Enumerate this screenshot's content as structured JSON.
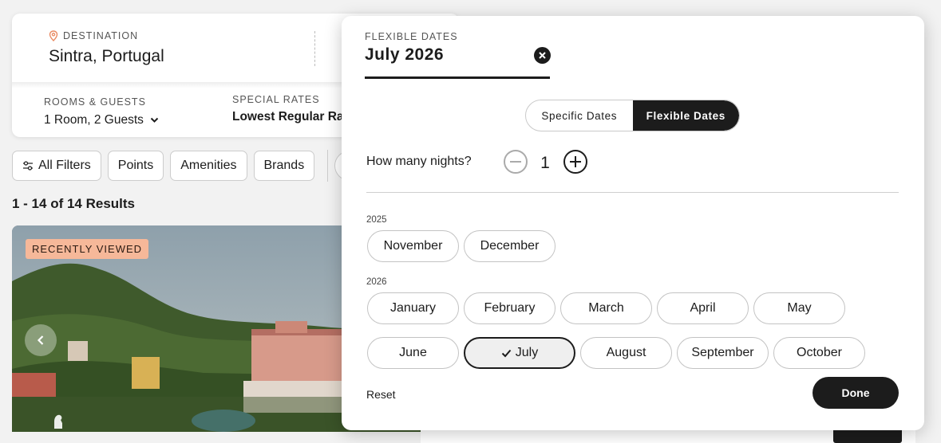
{
  "search": {
    "destination_label": "DESTINATION",
    "destination_value": "Sintra, Portugal",
    "rooms_label": "ROOMS & GUESTS",
    "rooms_value": "1 Room, 2 Guests",
    "special_rates_label": "SPECIAL RATES",
    "special_rates_value": "Lowest Regular Rate"
  },
  "filters": [
    {
      "label": "All Filters",
      "icon": "sliders-icon"
    },
    {
      "label": "Points"
    },
    {
      "label": "Amenities"
    },
    {
      "label": "Brands"
    }
  ],
  "results": {
    "count_text": "1 - 14 of 14 Results"
  },
  "hotel_card": {
    "badge": "RECENTLY VIEWED"
  },
  "picker": {
    "flexible_label": "FLEXIBLE DATES",
    "selected_value": "July 2026",
    "toggle": {
      "specific": "Specific Dates",
      "flexible": "Flexible Dates",
      "active": "flexible"
    },
    "nights_label": "How many nights?",
    "nights_value": "1",
    "years": [
      {
        "year": "2025",
        "months": [
          "November",
          "December"
        ]
      },
      {
        "year": "2026",
        "months": [
          "January",
          "February",
          "March",
          "April",
          "May"
        ],
        "months_row2": [
          "June",
          "July",
          "August",
          "September",
          "October"
        ]
      }
    ],
    "selected_month": "July",
    "reset_label": "Reset",
    "done_label": "Done"
  },
  "colors": {
    "primary": "#1c1c1c",
    "badge": "#f6b899",
    "pin": "#e98a62"
  }
}
